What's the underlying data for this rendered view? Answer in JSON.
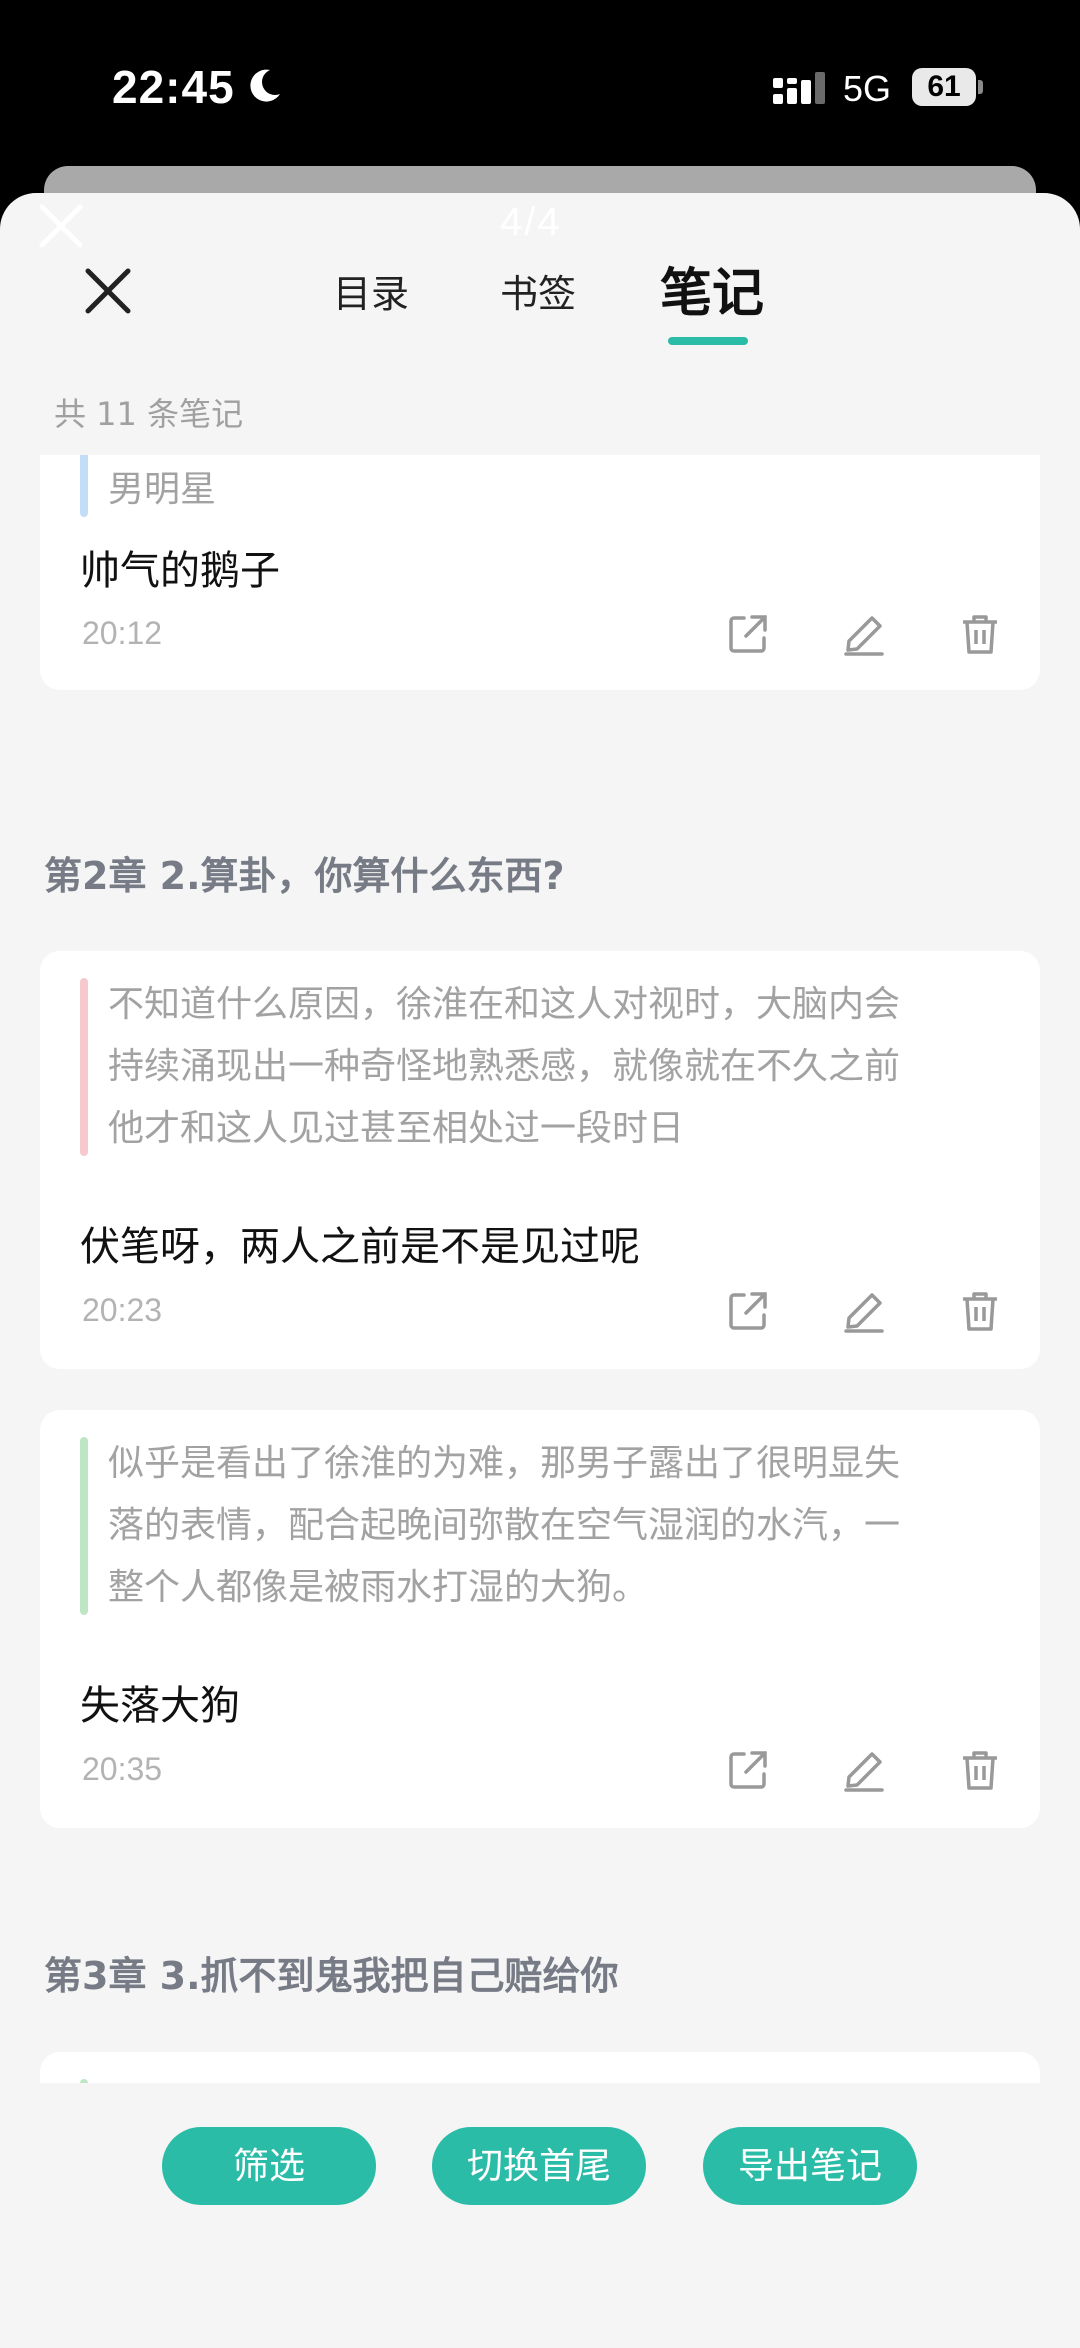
{
  "status_bar": {
    "time": "22:45",
    "network": "5G",
    "battery": "61"
  },
  "sheet": {
    "page_counter": "4/4"
  },
  "tabs": {
    "contents": "目录",
    "bookmarks": "书签",
    "notes": "笔记",
    "active": "notes"
  },
  "note_count": "共 11 条笔记",
  "colors": {
    "accent": "#2bbca8",
    "quote_blue": "#c3ddf8",
    "quote_red": "#f7c9cc",
    "quote_green": "#bfe6c4"
  },
  "top_card": {
    "quote_tail": "男明星",
    "note": "帅气的鹅子",
    "time": "20:12"
  },
  "chapters": [
    {
      "title": "第2章 2.算卦，你算什么东西?",
      "notes": [
        {
          "quote_lines": [
            "不知道什么原因，徐淮在和这人对视时，大脑内会",
            "持续涌现出一种奇怪地熟悉感，就像就在不久之前",
            "他才和这人见过甚至相处过一段时日"
          ],
          "note": "伏笔呀，两人之前是不是见过呢",
          "time": "20:23"
        },
        {
          "quote_lines": [
            "似乎是看出了徐淮的为难，那男子露出了很明显失",
            "落的表情，配合起晚间弥散在空气湿润的水汽，一",
            "整个人都像是被雨水打湿的大狗。"
          ],
          "note": "失落大狗",
          "time": "20:35"
        }
      ]
    },
    {
      "title": "第3章 3.抓不到鬼我把自己赔给你"
    }
  ],
  "actions": {
    "share": "share-icon",
    "edit": "edit-icon",
    "delete": "trash-icon"
  },
  "footer": {
    "filter": "筛选",
    "switch": "切换首尾",
    "export": "导出笔记"
  }
}
